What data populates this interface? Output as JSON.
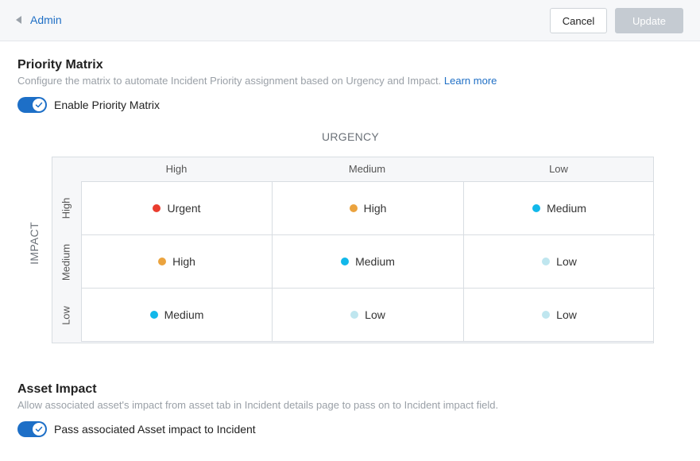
{
  "header": {
    "back_label": "Admin",
    "cancel_label": "Cancel",
    "update_label": "Update"
  },
  "priority_matrix": {
    "title": "Priority Matrix",
    "description": "Configure the matrix to automate Incident Priority assignment based on Urgency and Impact.",
    "learn_more": "Learn more",
    "toggle_label": "Enable Priority Matrix",
    "toggle_on": true,
    "urgency_label": "URGENCY",
    "impact_label": "IMPACT",
    "urgency_levels": [
      "High",
      "Medium",
      "Low"
    ],
    "impact_levels": [
      "High",
      "Medium",
      "Low"
    ],
    "rows": [
      [
        {
          "label": "Urgent",
          "color": "#ea3d2f"
        },
        {
          "label": "High",
          "color": "#eba33e"
        },
        {
          "label": "Medium",
          "color": "#12b8ea"
        }
      ],
      [
        {
          "label": "High",
          "color": "#eba33e"
        },
        {
          "label": "Medium",
          "color": "#12b8ea"
        },
        {
          "label": "Low",
          "color": "#bfe6ef"
        }
      ],
      [
        {
          "label": "Medium",
          "color": "#12b8ea"
        },
        {
          "label": "Low",
          "color": "#bfe6ef"
        },
        {
          "label": "Low",
          "color": "#bfe6ef"
        }
      ]
    ]
  },
  "asset_impact": {
    "title": "Asset Impact",
    "description": "Allow associated asset's impact from asset tab in Incident details page to pass on to Incident impact field.",
    "toggle_label": "Pass associated Asset impact to Incident",
    "toggle_on": true
  },
  "colors": {
    "accent": "#1d6fc7",
    "link": "#1f6fc5"
  }
}
